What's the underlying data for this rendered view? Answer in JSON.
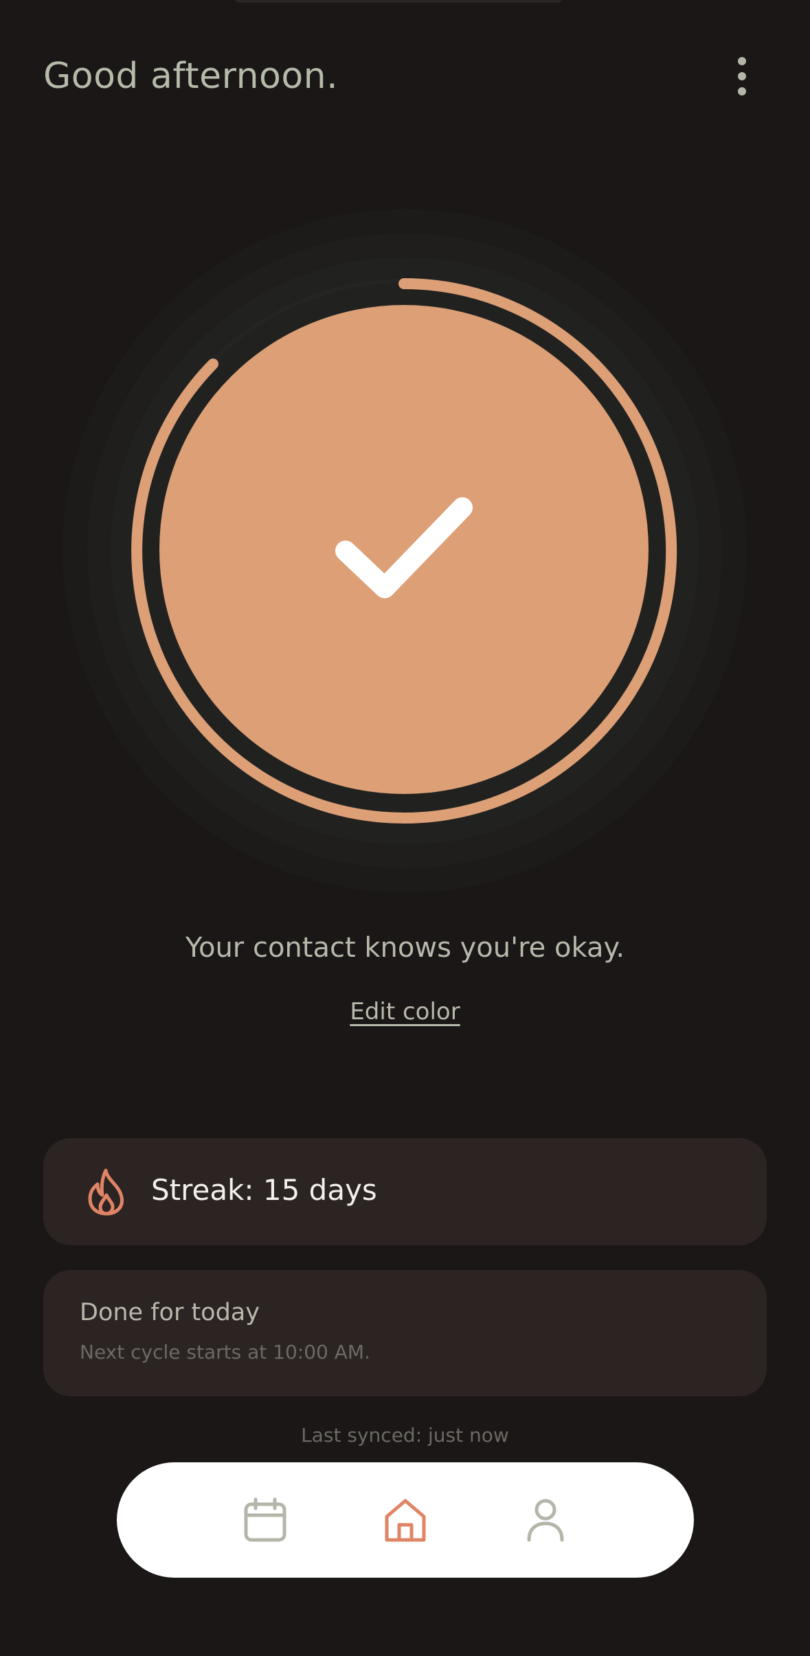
{
  "header": {
    "greeting": "Good afternoon.",
    "menu_icon": "more-vertical-icon"
  },
  "status_ring": {
    "state_icon": "checkmark-icon",
    "fill_color": "#dc9f76",
    "ring_color": "#dc9f76"
  },
  "status": {
    "message": "Your contact knows you're okay.",
    "edit_link": "Edit color"
  },
  "streak": {
    "icon": "flame-icon",
    "label": "Streak: 15 days",
    "accent_color": "#e08466"
  },
  "cycle": {
    "title": "Done for today",
    "subtitle": "Next cycle starts at 10:00 AM."
  },
  "sync": {
    "text": "Last synced: just now"
  },
  "bottom_nav": {
    "items": [
      {
        "icon": "calendar-icon",
        "active": false
      },
      {
        "icon": "home-icon",
        "active": true
      },
      {
        "icon": "profile-icon",
        "active": false
      }
    ],
    "active_color": "#e08466",
    "inactive_color": "#b3b6a8"
  }
}
